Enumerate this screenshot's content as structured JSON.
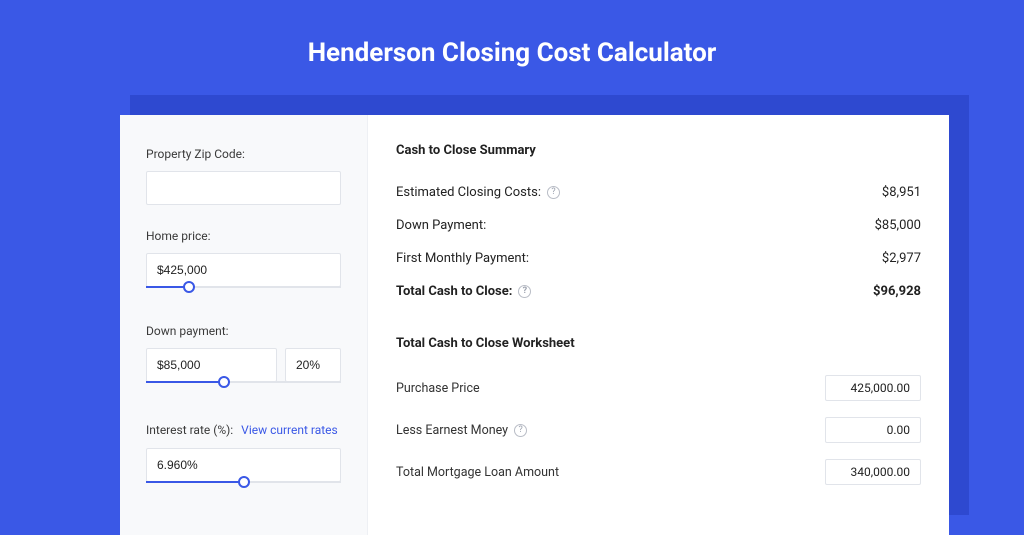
{
  "title": "Henderson Closing Cost Calculator",
  "left": {
    "zip_label": "Property Zip Code:",
    "zip_value": "",
    "home_price_label": "Home price:",
    "home_price_value": "$425,000",
    "home_price_slider_pct": 22,
    "down_payment_label": "Down payment:",
    "down_payment_value": "$85,000",
    "down_payment_pct_value": "20%",
    "down_payment_slider_pct": 40,
    "interest_label": "Interest rate (%):",
    "interest_link": "View current rates",
    "interest_value": "6.960%",
    "interest_slider_pct": 50
  },
  "summary": {
    "heading": "Cash to Close Summary",
    "rows": [
      {
        "label": "Estimated Closing Costs:",
        "help": true,
        "value": "$8,951",
        "bold": false
      },
      {
        "label": "Down Payment:",
        "help": false,
        "value": "$85,000",
        "bold": false
      },
      {
        "label": "First Monthly Payment:",
        "help": false,
        "value": "$2,977",
        "bold": false
      },
      {
        "label": "Total Cash to Close:",
        "help": true,
        "value": "$96,928",
        "bold": true
      }
    ]
  },
  "worksheet": {
    "heading": "Total Cash to Close Worksheet",
    "rows": [
      {
        "label": "Purchase Price",
        "help": false,
        "value": "425,000.00"
      },
      {
        "label": "Less Earnest Money",
        "help": true,
        "value": "0.00"
      },
      {
        "label": "Total Mortgage Loan Amount",
        "help": false,
        "value": "340,000.00"
      }
    ]
  }
}
